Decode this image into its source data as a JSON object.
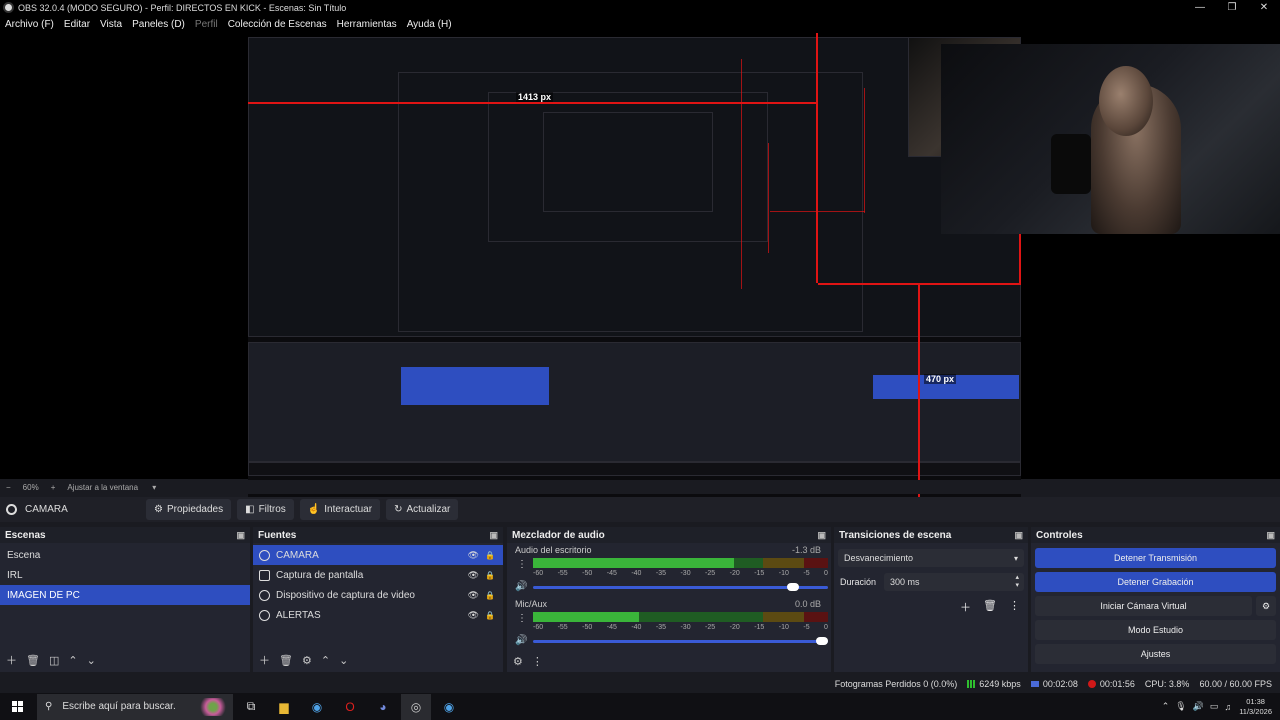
{
  "window": {
    "title": "OBS 32.0.4 (MODO SEGURO) - Perfil: DIRECTOS EN KICK - Escenas: Sin Título",
    "controls": [
      "—",
      "❐",
      "✕"
    ]
  },
  "menu": [
    "Archivo (F)",
    "Editar",
    "Vista",
    "Paneles (D)",
    "Perfil",
    "Colección de Escenas",
    "Herramientas",
    "Ayuda (H)"
  ],
  "preview": {
    "label_width": "1413 px",
    "label_height": "470 px",
    "zoom": "60%",
    "fit": "Ajustar a la ventana"
  },
  "scene_toolbar": {
    "current_source": "CAMARA",
    "buttons": [
      "Propiedades",
      "Filtros",
      "Interactuar",
      "Actualizar"
    ]
  },
  "scenes": {
    "title": "Escenas",
    "items": [
      "Escena",
      "IRL",
      "IMAGEN DE PC"
    ],
    "selected": "IMAGEN DE PC"
  },
  "sources": {
    "title": "Fuentes",
    "items": [
      "CAMARA",
      "Captura de pantalla",
      "Dispositivo de captura de video",
      "ALERTAS"
    ],
    "selected": "CAMARA"
  },
  "mixer": {
    "title": "Mezclador de audio",
    "channels": [
      {
        "name": "Audio del escritorio",
        "db": "-1.3 dB",
        "level": 0.68,
        "volume": 0.9
      },
      {
        "name": "Mic/Aux",
        "db": "0.0 dB",
        "level": 0.36,
        "volume": 1.0
      }
    ],
    "scale": [
      "-60",
      "-55",
      "-50",
      "-45",
      "-40",
      "-35",
      "-30",
      "-25",
      "-20",
      "-15",
      "-10",
      "-5",
      "0"
    ]
  },
  "transitions": {
    "title": "Transiciones de escena",
    "selected": "Desvanecimiento",
    "duration_label": "Duración",
    "duration_value": "300 ms"
  },
  "controls": {
    "title": "Controles",
    "stop_stream": "Detener Transmisión",
    "stop_record": "Detener Grabación",
    "virtual_cam": "Iniciar Cámara Virtual",
    "studio_mode": "Modo Estudio",
    "settings": "Ajustes"
  },
  "status": {
    "dropped_frames": "Fotogramas Perdidos 0 (0.0%)",
    "bitrate": "6249 kbps",
    "stream_time": "00:02:08",
    "record_time": "00:01:56",
    "cpu": "CPU: 3.8%",
    "fps": "60.00 / 60.00 FPS"
  },
  "taskbar": {
    "search_placeholder": "Escribe aquí para buscar.",
    "time": "01:38",
    "date": "11/3/2026"
  },
  "colors": {
    "accent": "#2e4ec0",
    "guide": "#e01414"
  }
}
